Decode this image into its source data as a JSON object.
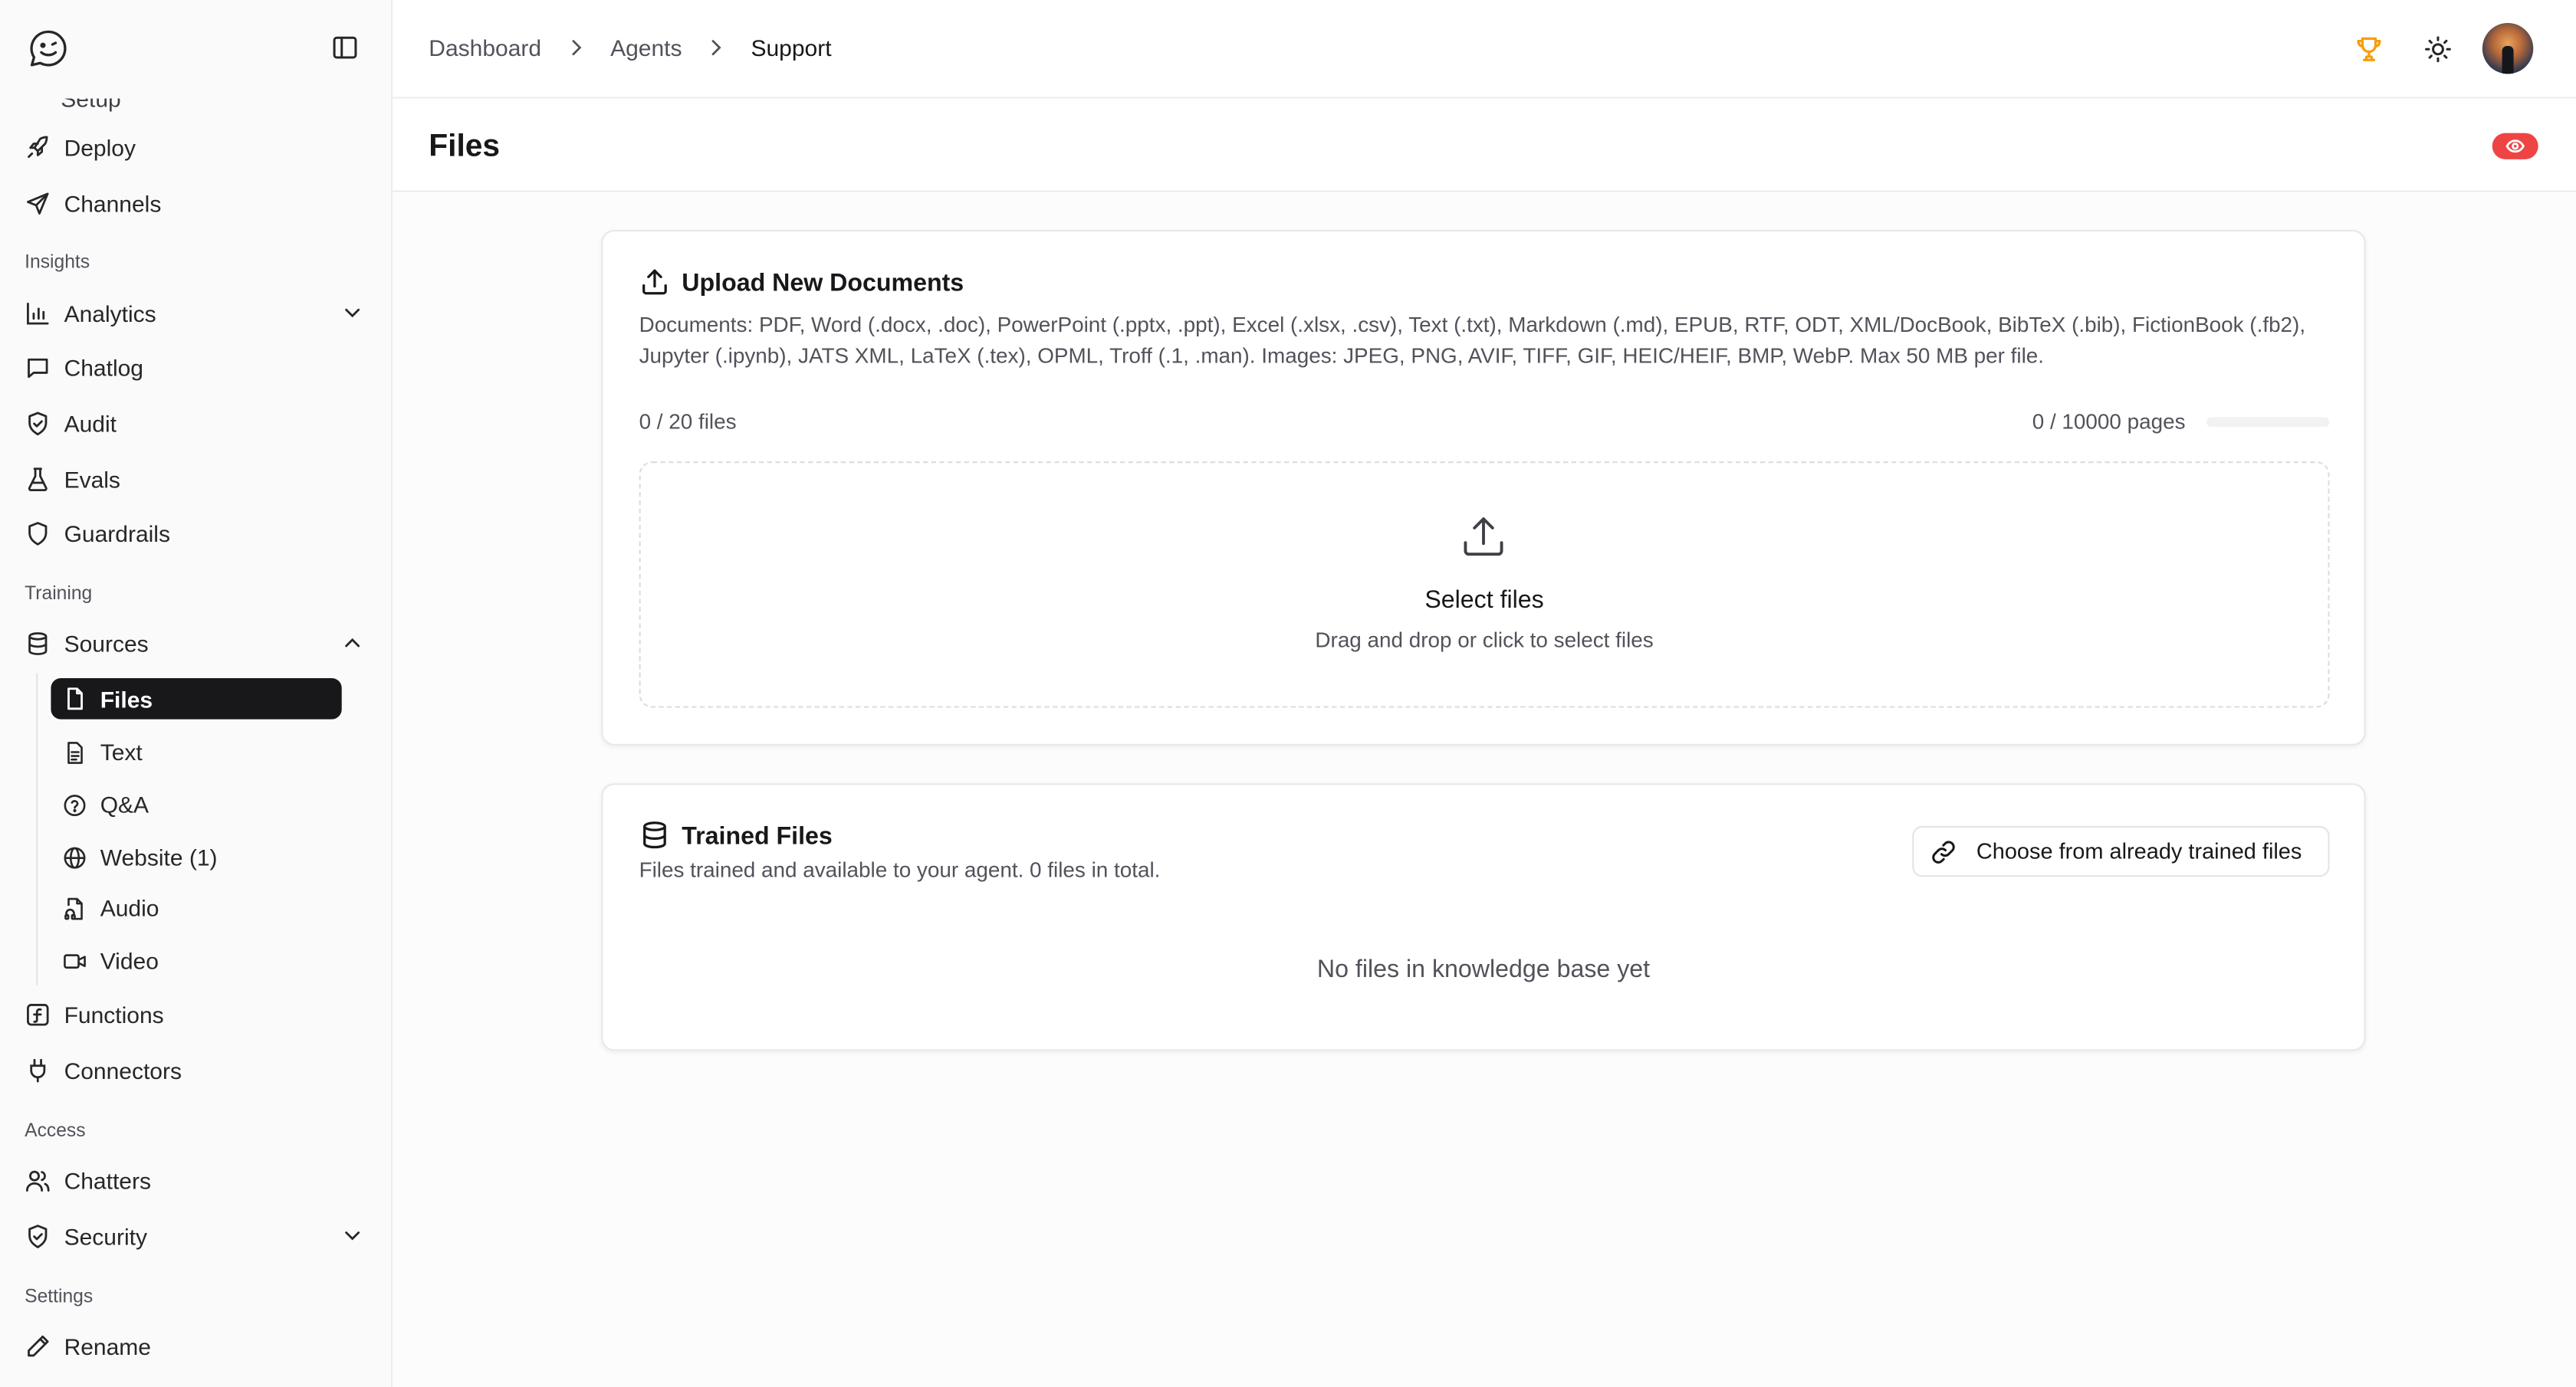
{
  "sidebar": {
    "setup_peek": "Setup",
    "deploy": "Deploy",
    "channels": "Channels",
    "group_insights": "Insights",
    "analytics": "Analytics",
    "chatlog": "Chatlog",
    "audit": "Audit",
    "evals": "Evals",
    "guardrails": "Guardrails",
    "group_training": "Training",
    "sources": "Sources",
    "sub_files": "Files",
    "sub_text": "Text",
    "sub_qa": "Q&A",
    "sub_website": "Website (1)",
    "sub_audio": "Audio",
    "sub_video": "Video",
    "functions": "Functions",
    "connectors": "Connectors",
    "group_access": "Access",
    "chatters": "Chatters",
    "security": "Security",
    "group_settings": "Settings",
    "rename": "Rename"
  },
  "header": {
    "breadcrumb": [
      "Dashboard",
      "Agents",
      "Support"
    ],
    "accent_color": "#f59e0b"
  },
  "page": {
    "title": "Files",
    "badge_color": "#ef4444"
  },
  "upload": {
    "title": "Upload New Documents",
    "description": "Documents: PDF, Word (.docx, .doc), PowerPoint (.pptx, .ppt), Excel (.xlsx, .csv), Text (.txt), Markdown (.md), EPUB, RTF, ODT, XML/DocBook, BibTeX (.bib), FictionBook (.fb2), Jupyter (.ipynb), JATS XML, LaTeX (.tex), OPML, Troff (.1, .man). Images: JPEG, PNG, AVIF, TIFF, GIF, HEIC/HEIF, BMP, WebP. Max 50 MB per file.",
    "files_count": "0 / 20 files",
    "pages_count": "0 / 10000 pages",
    "pages_progress_fraction": 0,
    "dropzone_title": "Select files",
    "dropzone_subtitle": "Drag and drop or click to select files"
  },
  "trained": {
    "title": "Trained Files",
    "description": "Files trained and available to your agent. 0 files in total.",
    "choose_button": "Choose from already trained files",
    "empty": "No files in knowledge base yet"
  }
}
